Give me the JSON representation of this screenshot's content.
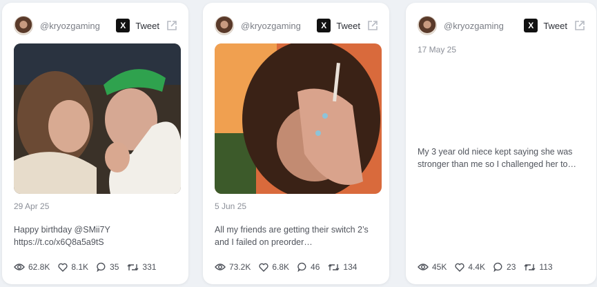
{
  "cards": [
    {
      "handle": "@kryozgaming",
      "tweet_label": "Tweet",
      "date": "29 Apr 25",
      "text_lines": [
        "Happy birthday @SMii7Y",
        "https://t.co/x6Q8a5a9tS"
      ],
      "stats": {
        "views": "62.8K",
        "likes": "8.1K",
        "replies": "35",
        "retweets": "331"
      }
    },
    {
      "handle": "@kryozgaming",
      "tweet_label": "Tweet",
      "date": "5 Jun 25",
      "text_lines": [
        "All my friends are getting their switch 2’s",
        "and I failed on preorder…"
      ],
      "stats": {
        "views": "73.2K",
        "likes": "6.8K",
        "replies": "46",
        "retweets": "134"
      }
    },
    {
      "handle": "@kryozgaming",
      "tweet_label": "Tweet",
      "date": "17 May 25",
      "text_lines": [
        "My 3 year old niece kept saying she was",
        "stronger than me so I challenged her to…"
      ],
      "stats": {
        "views": "45K",
        "likes": "4.4K",
        "replies": "23",
        "retweets": "113"
      }
    }
  ],
  "icons": {
    "x_logo": "X",
    "external_link": "external-link-icon",
    "views": "eye-icon",
    "likes": "heart-icon",
    "replies": "comment-icon",
    "retweets": "retweet-icon"
  }
}
